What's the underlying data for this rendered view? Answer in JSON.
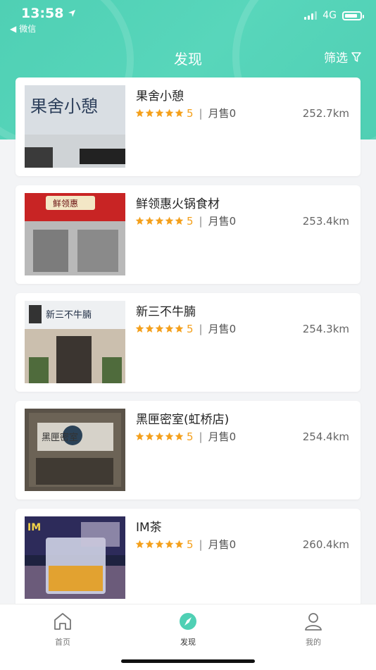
{
  "status_bar": {
    "time": "13:58",
    "back_app": "微信",
    "network": "4G",
    "battery_level": 0.85
  },
  "header": {
    "title": "发现",
    "filter_label": "筛选"
  },
  "stores": [
    {
      "name": "果舍小憩",
      "rating": "5",
      "sales": "月售0",
      "distance": "252.7km",
      "stars": 5,
      "sign": "果舍小憩"
    },
    {
      "name": "鲜领惠火锅食材",
      "rating": "5",
      "sales": "月售0",
      "distance": "253.4km",
      "stars": 5,
      "sign": "鲜领惠"
    },
    {
      "name": "新三不牛腩",
      "rating": "5",
      "sales": "月售0",
      "distance": "254.3km",
      "stars": 5,
      "sign": "新三不牛腩"
    },
    {
      "name": "黑匣密室(虹桥店)",
      "rating": "5",
      "sales": "月售0",
      "distance": "254.4km",
      "stars": 5,
      "sign": "黑匣密室"
    },
    {
      "name": "IM茶",
      "rating": "5",
      "sales": "月售0",
      "distance": "260.4km",
      "stars": 5,
      "sign": "IM"
    }
  ],
  "tabbar": {
    "home": "首页",
    "discover": "发现",
    "mine": "我的"
  },
  "colors": {
    "accent": "#4fd0b4",
    "star": "#f4a01c"
  }
}
